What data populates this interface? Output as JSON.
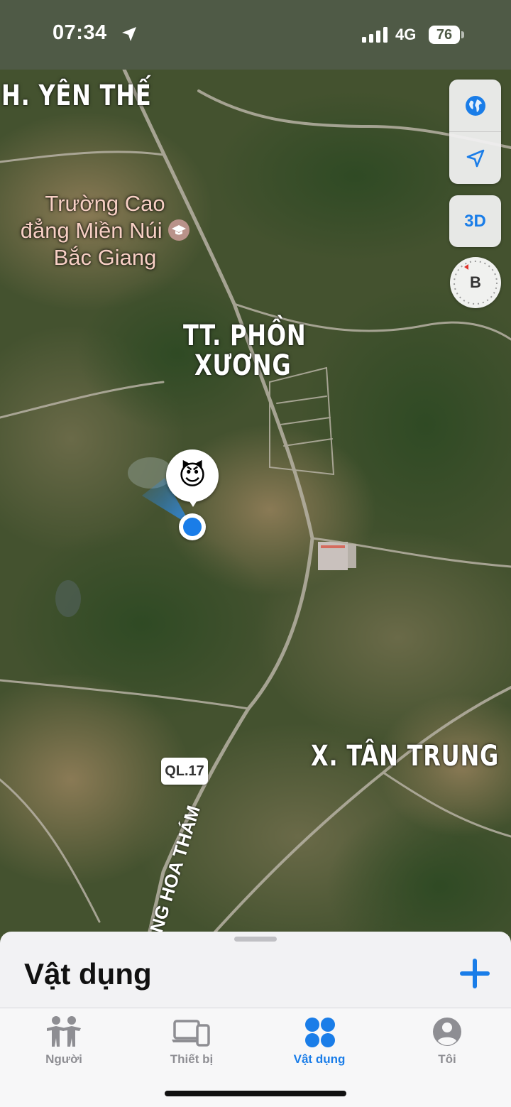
{
  "status_bar": {
    "time": "07:34",
    "network": "4G",
    "battery": "76"
  },
  "map": {
    "labels": {
      "yen_the": "H. YÊN THẾ",
      "poi_line1": "Trường Cao",
      "poi_line2": "đẳng Miền Núi",
      "poi_line3": "Bắc Giang",
      "phon_xuong_1": "TT. PHỒN",
      "phon_xuong_2": "XƯƠNG",
      "tan_trung": "X. TÂN TRUNG",
      "road_shield": "QL.17",
      "street": "NG HOA THÁM"
    },
    "item_emoji": "😈"
  },
  "controls": {
    "three_d": "3D",
    "compass": "B"
  },
  "sheet": {
    "title": "Vật dụng"
  },
  "tabs": [
    {
      "label": "Người"
    },
    {
      "label": "Thiết bị"
    },
    {
      "label": "Vật dụng"
    },
    {
      "label": "Tôi"
    }
  ],
  "colors": {
    "accent": "#1a7de8",
    "inactive": "#8e8e93",
    "status_bg": "#4f5a46"
  }
}
